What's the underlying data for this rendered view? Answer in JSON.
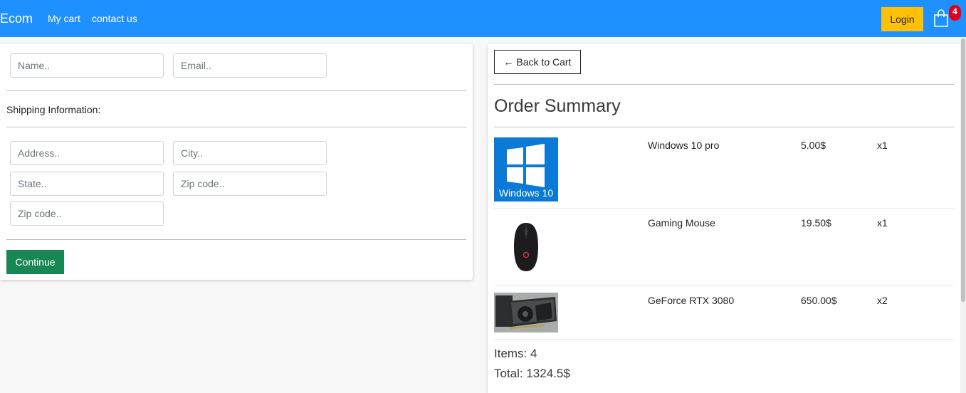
{
  "navbar": {
    "brand": "Ecom",
    "links": [
      "My cart",
      "contact us"
    ],
    "login_label": "Login",
    "cart_count": "4",
    "cart_icon": "shopping-bag-icon",
    "bg_color": "#1e90ff"
  },
  "form": {
    "name_placeholder": "Name..",
    "email_placeholder": "Email..",
    "shipping_label": "Shipping Information:",
    "address_placeholder": "Address..",
    "city_placeholder": "City..",
    "state_placeholder": "State..",
    "zip_placeholder": "Zip code..",
    "zip2_placeholder": "Zip code..",
    "continue_label": "Continue"
  },
  "summary": {
    "back_label": "← Back to Cart",
    "title": "Order Summary",
    "items": [
      {
        "image": "windows-10-logo",
        "image_text": "Windows 10",
        "name": "Windows 10 pro",
        "price": "5.00$",
        "qty": "x1"
      },
      {
        "image": "gaming-mouse-photo",
        "name": "Gaming Mouse",
        "price": "19.50$",
        "qty": "x1"
      },
      {
        "image": "gpu-photo",
        "name": "GeForce RTX 3080",
        "price": "650.00$",
        "qty": "x2"
      }
    ],
    "items_total": "Items: 4",
    "price_total": "Total: 1324.5$"
  }
}
